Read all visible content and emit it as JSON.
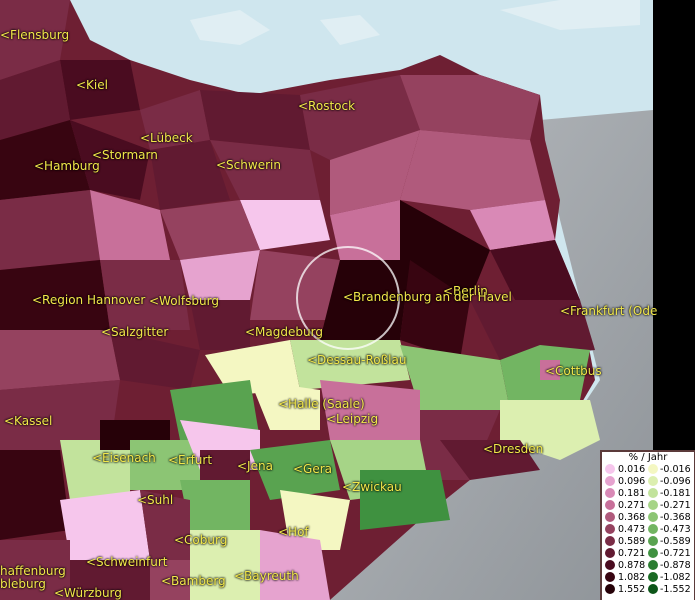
{
  "cities": [
    {
      "label": "<Flensburg"
    },
    {
      "label": "<Kiel"
    },
    {
      "label": "<Rostock"
    },
    {
      "label": "<Lübeck"
    },
    {
      "label": "<Stormarn"
    },
    {
      "label": "<Hamburg"
    },
    {
      "label": "<Schwerin"
    },
    {
      "label": "<Berlin"
    },
    {
      "label": "<Brandenburg an der Havel"
    },
    {
      "label": "<Frankfurt (Ode"
    },
    {
      "label": "<Region Hannover"
    },
    {
      "label": "<Wolfsburg"
    },
    {
      "label": "<Salzgitter"
    },
    {
      "label": "<Magdeburg"
    },
    {
      "label": "<Dessau-Roßlau"
    },
    {
      "label": "<Cottbus"
    },
    {
      "label": "<Kassel"
    },
    {
      "label": "<Halle (Saale)"
    },
    {
      "label": "<Leipzig"
    },
    {
      "label": "<Dresden"
    },
    {
      "label": "<Eisenach"
    },
    {
      "label": "<Erfurt"
    },
    {
      "label": "<Jena"
    },
    {
      "label": "<Gera"
    },
    {
      "label": "<Zwickau"
    },
    {
      "label": "<Suhl"
    },
    {
      "label": "<Coburg"
    },
    {
      "label": "<Hof"
    },
    {
      "label": "<Schweinfurt"
    },
    {
      "label": "<Bamberg"
    },
    {
      "label": "<Bayreuth"
    },
    {
      "label": "<Würzburg"
    },
    {
      "label": "haffenburg"
    },
    {
      "label": "bleburg"
    }
  ],
  "legend": {
    "title": "% / Jahr",
    "positive": [
      "0.016",
      "0.096",
      "0.181",
      "0.271",
      "0.368",
      "0.473",
      "0.589",
      "0.721",
      "0.878",
      "1.082",
      "1.552"
    ],
    "negative": [
      "-0.016",
      "-0.096",
      "-0.181",
      "-0.271",
      "-0.368",
      "-0.473",
      "-0.589",
      "-0.721",
      "-0.878",
      "-1.082",
      "-1.552"
    ],
    "positive_colors": [
      "#f6c6ec",
      "#e6a3cf",
      "#d989b6",
      "#c8709a",
      "#b05a7c",
      "#95425f",
      "#7a2c46",
      "#611a31",
      "#4a0c20",
      "#380511",
      "#260108"
    ],
    "negative_colors": [
      "#f4f7c2",
      "#dcefb0",
      "#c2e39c",
      "#a6d487",
      "#8cc574",
      "#72b562",
      "#59a350",
      "#3f9140",
      "#2b7d31",
      "#1a6a24",
      "#0c5518"
    ]
  },
  "colors": {
    "sea": "#cfe6ee",
    "terrain": "#9da3a8"
  }
}
